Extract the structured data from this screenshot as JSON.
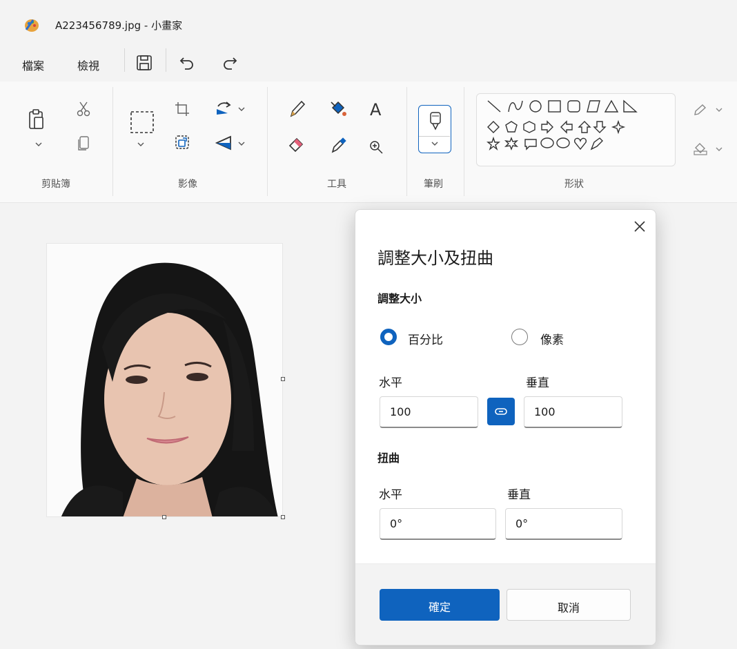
{
  "window": {
    "title": "A223456789.jpg - 小畫家"
  },
  "menubar": {
    "file": "檔案",
    "view": "檢視"
  },
  "ribbon": {
    "groups": {
      "clipboard": "剪貼簿",
      "image": "影像",
      "tools": "工具",
      "brushes": "筆刷",
      "shapes": "形狀"
    },
    "text_tool_glyph": "A"
  },
  "dialog": {
    "title": "調整大小及扭曲",
    "resize_section": "調整大小",
    "radio_percent": "百分比",
    "radio_pixels": "像素",
    "resize_horizontal_label": "水平",
    "resize_vertical_label": "垂直",
    "resize_horizontal_value": "100",
    "resize_vertical_value": "100",
    "skew_section": "扭曲",
    "skew_horizontal_label": "水平",
    "skew_vertical_label": "垂直",
    "skew_horizontal_value": "0°",
    "skew_vertical_value": "0°",
    "ok": "確定",
    "cancel": "取消",
    "selected_mode": "百分比",
    "maintain_aspect_ratio": true
  },
  "colors": {
    "accent": "#0f63be"
  }
}
